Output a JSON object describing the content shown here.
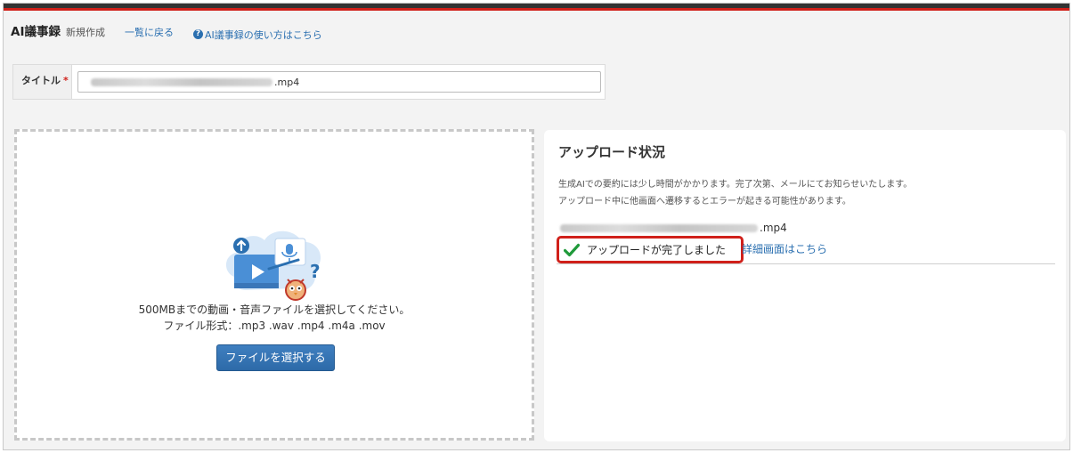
{
  "header": {
    "app_title": "AI議事録",
    "subtitle": "新規作成",
    "back_link": "一覧に戻る",
    "help_link": "AI議事録の使い方はこちら"
  },
  "title_field": {
    "label": "タイトル",
    "required_mark": "*",
    "value_suffix": ".mp4"
  },
  "dropzone": {
    "line1": "500MBまでの動画・音声ファイルを選択してください。",
    "line2": "ファイル形式：.mp3 .wav .mp4 .m4a .mov",
    "button_label": "ファイルを選択する"
  },
  "status": {
    "title": "アップロード状況",
    "note1": "生成AIでの要約には少し時間がかかります。完了次第、メールにてお知らせいたします。",
    "note2": "アップロード中に他画面へ遷移するとエラーが起きる可能性があります。",
    "file_suffix": ".mp4",
    "complete_text": "アップロードが完了しました",
    "detail_link": "詳細画面はこちら"
  },
  "colors": {
    "accent_red": "#d0201a",
    "link_blue": "#2a6fb0",
    "button_blue": "#2d6aa8",
    "check_green": "#1f9a3a"
  }
}
